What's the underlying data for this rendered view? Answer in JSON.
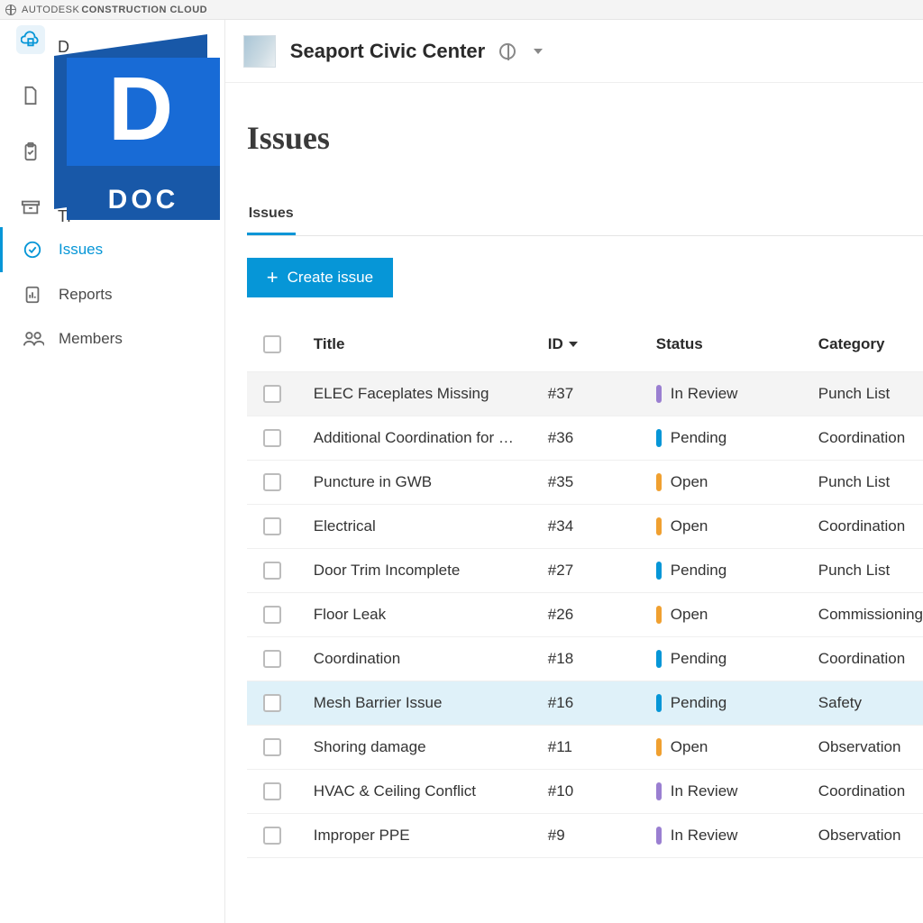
{
  "brand": {
    "prefix": "AUTODESK",
    "suffix": "CONSTRUCTION CLOUD"
  },
  "doc_logo": {
    "letter": "D",
    "label": "DOC"
  },
  "sidebar": {
    "tool_rows": [
      {
        "label": "D"
      },
      {
        "label": "",
        "truncated": true
      },
      {
        "label": ""
      },
      {
        "label": ""
      },
      {
        "label": "Tr",
        "truncated": true
      }
    ],
    "items": [
      {
        "label": "Issues",
        "active": true
      },
      {
        "label": "Reports",
        "active": false
      },
      {
        "label": "Members",
        "active": false
      }
    ]
  },
  "project": {
    "name": "Seaport Civic Center"
  },
  "page": {
    "title": "Issues"
  },
  "tabs": [
    {
      "label": "Issues",
      "active": true
    }
  ],
  "buttons": {
    "create": "Create issue"
  },
  "table": {
    "headers": {
      "title": "Title",
      "id": "ID",
      "status": "Status",
      "category": "Category"
    },
    "rows": [
      {
        "title": "ELEC Faceplates Missing",
        "id": "#37",
        "status": "In Review",
        "status_kind": "review",
        "category": "Punch List",
        "row_state": "hover"
      },
      {
        "title": "Additional Coordination for …",
        "id": "#36",
        "status": "Pending",
        "status_kind": "pending",
        "category": "Coordination",
        "row_state": ""
      },
      {
        "title": "Puncture in GWB",
        "id": "#35",
        "status": "Open",
        "status_kind": "open",
        "category": "Punch List",
        "row_state": ""
      },
      {
        "title": "Electrical",
        "id": "#34",
        "status": "Open",
        "status_kind": "open",
        "category": "Coordination",
        "row_state": ""
      },
      {
        "title": "Door Trim Incomplete",
        "id": "#27",
        "status": "Pending",
        "status_kind": "pending",
        "category": "Punch List",
        "row_state": ""
      },
      {
        "title": "Floor Leak",
        "id": "#26",
        "status": "Open",
        "status_kind": "open",
        "category": "Commissioning",
        "row_state": ""
      },
      {
        "title": "Coordination",
        "id": "#18",
        "status": "Pending",
        "status_kind": "pending",
        "category": "Coordination",
        "row_state": ""
      },
      {
        "title": "Mesh Barrier Issue",
        "id": "#16",
        "status": "Pending",
        "status_kind": "pending",
        "category": "Safety",
        "row_state": "selected"
      },
      {
        "title": "Shoring damage",
        "id": "#11",
        "status": "Open",
        "status_kind": "open",
        "category": "Observation",
        "row_state": ""
      },
      {
        "title": "HVAC & Ceiling Conflict",
        "id": "#10",
        "status": "In Review",
        "status_kind": "review",
        "category": "Coordination",
        "row_state": ""
      },
      {
        "title": "Improper PPE",
        "id": "#9",
        "status": "In Review",
        "status_kind": "review",
        "category": "Observation",
        "row_state": ""
      }
    ]
  }
}
